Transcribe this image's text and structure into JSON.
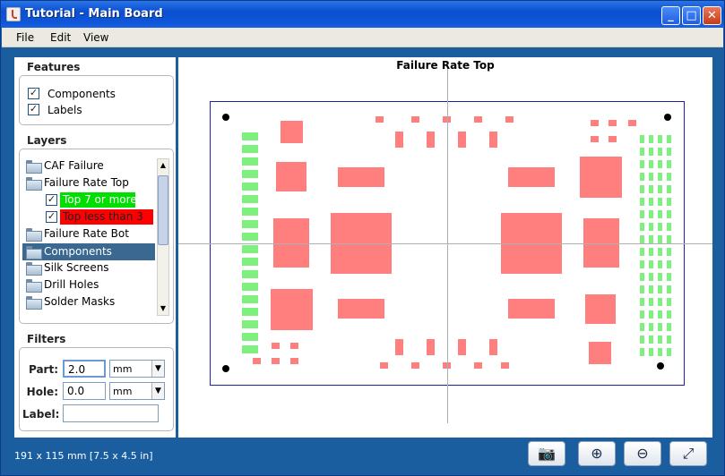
{
  "window": {
    "title": "Tutorial - Main Board"
  },
  "menu": {
    "file": "File",
    "edit": "Edit",
    "view": "View"
  },
  "features": {
    "label": "Features",
    "items": [
      {
        "label": "Components",
        "checked": true
      },
      {
        "label": "Labels",
        "checked": true
      }
    ]
  },
  "layers": {
    "label": "Layers",
    "items": [
      {
        "label": "CAF Failure"
      },
      {
        "label": "Failure Rate Top"
      },
      {
        "label": "Top 7 or more",
        "color": "#00e000"
      },
      {
        "label": "Top less than 3",
        "color": "#ff0000"
      },
      {
        "label": "Failure Rate Bot"
      },
      {
        "label": "Components",
        "selected": true
      },
      {
        "label": "Silk Screens"
      },
      {
        "label": "Drill Holes"
      },
      {
        "label": "Solder Masks"
      }
    ]
  },
  "filters": {
    "label": "Filters",
    "part_label": "Part:",
    "part_value": "2.0",
    "part_unit": "mm",
    "hole_label": "Hole:",
    "hole_value": "0.0",
    "hole_unit": "mm",
    "label_label": "Label:",
    "label_value": ""
  },
  "view": {
    "title": "Failure Rate Top",
    "pad_color": "#ff7f7f",
    "green_pad_color": "#7ff07f"
  },
  "status": {
    "dimensions": "191 x 115 mm  [7.5 x 4.5 in]"
  },
  "toolbar": {
    "camera": "camera-icon",
    "zoom_in": "zoom-in-icon",
    "zoom_out": "zoom-out-icon",
    "fit": "fit-icon"
  }
}
